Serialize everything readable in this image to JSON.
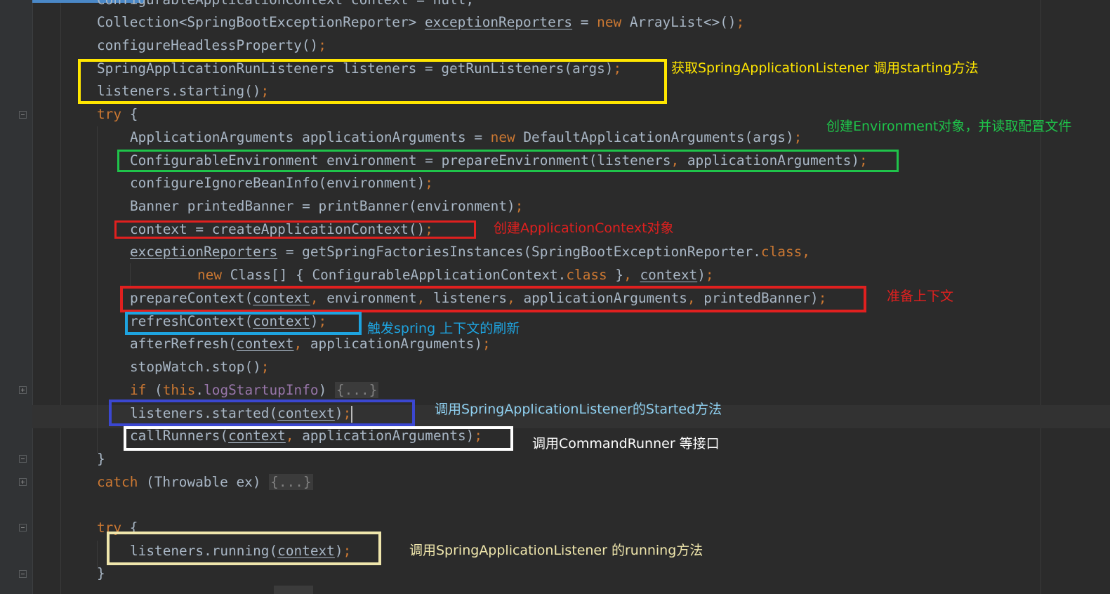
{
  "colors": {
    "background": "#2b2b2b",
    "text": "#a9b7c6",
    "keyword": "#cc7832",
    "field": "#9876aa",
    "yellow": "#ffe600",
    "green": "#1fc34a",
    "red": "#e0201f",
    "cyan": "#1ea4e0",
    "blue": "#3b47d1",
    "white": "#ffffff",
    "beige": "#efe6ac"
  },
  "code": {
    "line_top": "ConfigurableApplicationContext context = null;",
    "line1": [
      {
        "t": "Collection<SpringBootExceptionReporter> "
      },
      {
        "t": "exceptionReporters",
        "c": "ul"
      },
      {
        "t": " = "
      },
      {
        "t": "new",
        "c": "kw"
      },
      {
        "t": " ArrayList<>()"
      },
      {
        "t": ";",
        "c": "punc"
      }
    ],
    "line2": [
      {
        "t": "configureHeadlessProperty()"
      },
      {
        "t": ";",
        "c": "punc"
      }
    ],
    "line3": [
      {
        "t": "SpringApplicationRunListeners listeners = getRunListeners(args)"
      },
      {
        "t": ";",
        "c": "punc"
      }
    ],
    "line4": [
      {
        "t": "listeners.starting()"
      },
      {
        "t": ";",
        "c": "punc"
      }
    ],
    "line5": [
      {
        "t": "try",
        "c": "kw"
      },
      {
        "t": " {"
      }
    ],
    "line6": [
      {
        "t": "ApplicationArguments applicationArguments = "
      },
      {
        "t": "new",
        "c": "kw"
      },
      {
        "t": " DefaultApplicationArguments(args)"
      },
      {
        "t": ";",
        "c": "punc"
      }
    ],
    "line7": [
      {
        "t": "ConfigurableEnvironment environment = prepareEnvironment(listeners"
      },
      {
        "t": ", ",
        "c": "punc"
      },
      {
        "t": "applicationArguments)"
      },
      {
        "t": ";",
        "c": "punc"
      }
    ],
    "line8": [
      {
        "t": "configureIgnoreBeanInfo(environment)"
      },
      {
        "t": ";",
        "c": "punc"
      }
    ],
    "line9": [
      {
        "t": "Banner printedBanner = printBanner(environment)"
      },
      {
        "t": ";",
        "c": "punc"
      }
    ],
    "line10": [
      {
        "t": "context = createApplicationContext()"
      },
      {
        "t": ";",
        "c": "punc"
      }
    ],
    "line11": [
      {
        "t": "exceptionReporters",
        "c": "ul"
      },
      {
        "t": " = getSpringFactoriesInstances(SpringBootExceptionReporter."
      },
      {
        "t": "class",
        "c": "kw"
      },
      {
        "t": ",",
        "c": "punc"
      }
    ],
    "line12": [
      {
        "t": "new",
        "c": "kw"
      },
      {
        "t": " Class[] { ConfigurableApplicationContext."
      },
      {
        "t": "class",
        "c": "kw"
      },
      {
        "t": " }"
      },
      {
        "t": ", ",
        "c": "punc"
      },
      {
        "t": "context",
        "c": "ul"
      },
      {
        "t": ")"
      },
      {
        "t": ";",
        "c": "punc"
      }
    ],
    "line13": [
      {
        "t": "prepareContext("
      },
      {
        "t": "context",
        "c": "ul"
      },
      {
        "t": ", ",
        "c": "punc"
      },
      {
        "t": "environment"
      },
      {
        "t": ", ",
        "c": "punc"
      },
      {
        "t": "listeners"
      },
      {
        "t": ", ",
        "c": "punc"
      },
      {
        "t": "applicationArguments"
      },
      {
        "t": ", ",
        "c": "punc"
      },
      {
        "t": "printedBanner)"
      },
      {
        "t": ";",
        "c": "punc"
      }
    ],
    "line14": [
      {
        "t": "refreshContext("
      },
      {
        "t": "context",
        "c": "ul"
      },
      {
        "t": ")"
      },
      {
        "t": ";",
        "c": "punc"
      }
    ],
    "line15": [
      {
        "t": "afterRefresh("
      },
      {
        "t": "context",
        "c": "ul"
      },
      {
        "t": ", ",
        "c": "punc"
      },
      {
        "t": "applicationArguments)"
      },
      {
        "t": ";",
        "c": "punc"
      }
    ],
    "line16": [
      {
        "t": "stopWatch.stop()"
      },
      {
        "t": ";",
        "c": "punc"
      }
    ],
    "line17": [
      {
        "t": "if",
        "c": "kw"
      },
      {
        "t": " ("
      },
      {
        "t": "this",
        "c": "kw"
      },
      {
        "t": "."
      },
      {
        "t": "logStartupInfo",
        "c": "field"
      },
      {
        "t": ") "
      },
      {
        "t": "{...}",
        "c": "fold"
      }
    ],
    "line18": [
      {
        "t": "listeners.started("
      },
      {
        "t": "context",
        "c": "ul"
      },
      {
        "t": ")"
      },
      {
        "t": ";",
        "c": "punc"
      },
      {
        "t": "",
        "c": "caret"
      }
    ],
    "line19": [
      {
        "t": "callRunners("
      },
      {
        "t": "context",
        "c": "ul"
      },
      {
        "t": ", ",
        "c": "punc"
      },
      {
        "t": "applicationArguments)"
      },
      {
        "t": ";",
        "c": "punc"
      }
    ],
    "line20": [
      {
        "t": "}"
      }
    ],
    "line21": [
      {
        "t": "catch",
        "c": "kw"
      },
      {
        "t": " (Throwable ex) "
      },
      {
        "t": "{...}",
        "c": "fold"
      }
    ],
    "line22": [
      {
        "t": "try",
        "c": "kw"
      },
      {
        "t": " {"
      }
    ],
    "line23": [
      {
        "t": "listeners.running("
      },
      {
        "t": "context",
        "c": "ul"
      },
      {
        "t": ")"
      },
      {
        "t": ";",
        "c": "punc"
      }
    ],
    "line24": [
      {
        "t": "}"
      }
    ]
  },
  "annotations": {
    "listeners_starting": "获取SpringApplicationListener 调用starting方法",
    "environment": "创建Environment对象，并读取配置文件",
    "context": "创建ApplicationContext对象",
    "prepare": "准备上下文",
    "refresh": "触发spring 上下文的刷新",
    "started": "调用SpringApplicationListener的Started方法",
    "runners": "调用CommandRunner 等接口",
    "running": "调用SpringApplicationListener 的running方法"
  }
}
